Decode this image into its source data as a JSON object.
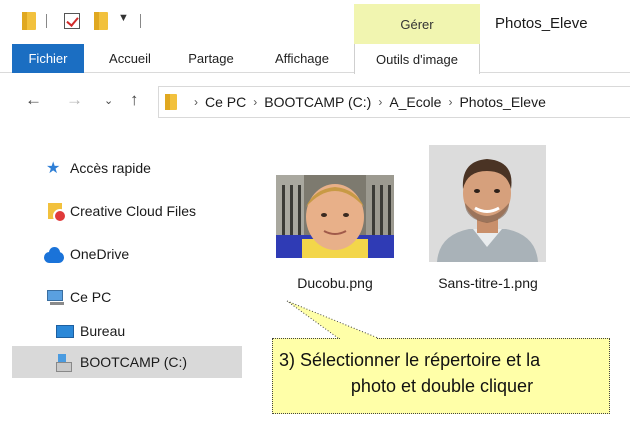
{
  "titlebar": {
    "context_group_label": "Gérer",
    "window_title": "Photos_Eleve"
  },
  "ribbon": {
    "tabs": [
      {
        "label": "Fichier"
      },
      {
        "label": "Accueil"
      },
      {
        "label": "Partage"
      },
      {
        "label": "Affichage"
      },
      {
        "label": "Outils d'image"
      }
    ]
  },
  "address": {
    "breadcrumbs": [
      "Ce PC",
      "BOOTCAMP (C:)",
      "A_Ecole",
      "Photos_Eleve"
    ]
  },
  "nav_pane": {
    "items": [
      {
        "label": "Accès rapide",
        "icon": "star-icon"
      },
      {
        "label": "Creative Cloud Files",
        "icon": "creative-cloud-folder-icon"
      },
      {
        "label": "OneDrive",
        "icon": "cloud-icon"
      },
      {
        "label": "Ce PC",
        "icon": "computer-icon"
      },
      {
        "label": "Bureau",
        "icon": "desktop-icon"
      },
      {
        "label": "BOOTCAMP (C:)",
        "icon": "drive-icon",
        "selected": true
      }
    ]
  },
  "files": [
    {
      "name": "Ducobu.png"
    },
    {
      "name": "Sans-titre-1.png"
    }
  ],
  "callout": {
    "line1": "3) Sélectionner le répertoire et la",
    "line2": "photo et double cliquer"
  },
  "colors": {
    "file_tab": "#1b6ec2",
    "context_header": "#f1f5b0",
    "selected_item": "#d9d9d9",
    "callout_bg": "#ffffa8"
  }
}
